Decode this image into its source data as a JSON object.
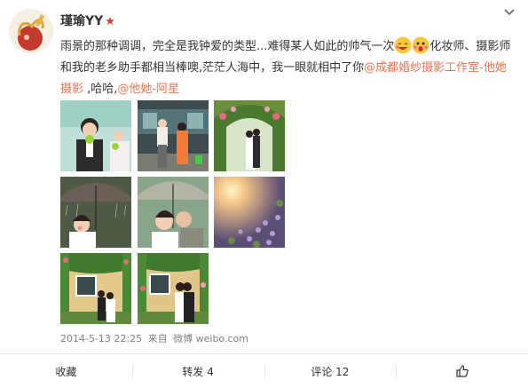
{
  "post": {
    "username": "瑾瑜YY",
    "verified_icon": "star-icon",
    "text_before": "雨景的那种调调，完全是我钟爱的类型...难得某人如此的帅气一次",
    "emoji1": "laughing-emoji",
    "emoji2": "surprised-emoji",
    "text_middle": "化妆师、摄影师和我的老乡助手都相当棒噢,茫茫人海中，我一眼就相中了你",
    "mention1": "@成都婚纱摄影工作室-他她摄影",
    "text_after": " ,哈哈,",
    "mention2": "@他她-阿星",
    "timestamp": "2014-5-13 22:25",
    "source_prefix": "来自",
    "source": "微博 weibo.com"
  },
  "photos": [
    {
      "name": "photo-1",
      "theme": "couple-green-apples"
    },
    {
      "name": "photo-2",
      "theme": "couple-train-station"
    },
    {
      "name": "photo-3",
      "theme": "couple-flower-arch"
    },
    {
      "name": "photo-4",
      "theme": "bride-umbrella-rain"
    },
    {
      "name": "photo-5",
      "theme": "kiss-umbrella-rain"
    },
    {
      "name": "photo-6",
      "theme": "sunlight-flowers"
    },
    {
      "name": "photo-7",
      "theme": "couple-cottage-vines"
    },
    {
      "name": "photo-8",
      "theme": "kiss-cottage-vines"
    }
  ],
  "actions": {
    "favorite": "收藏",
    "repost": "转发 4",
    "comment": "评论 12",
    "like_icon": "thumbs-up-icon"
  },
  "colors": {
    "link": "#eb7350",
    "verified_star": "#e8372b",
    "meta_text": "#808080"
  }
}
